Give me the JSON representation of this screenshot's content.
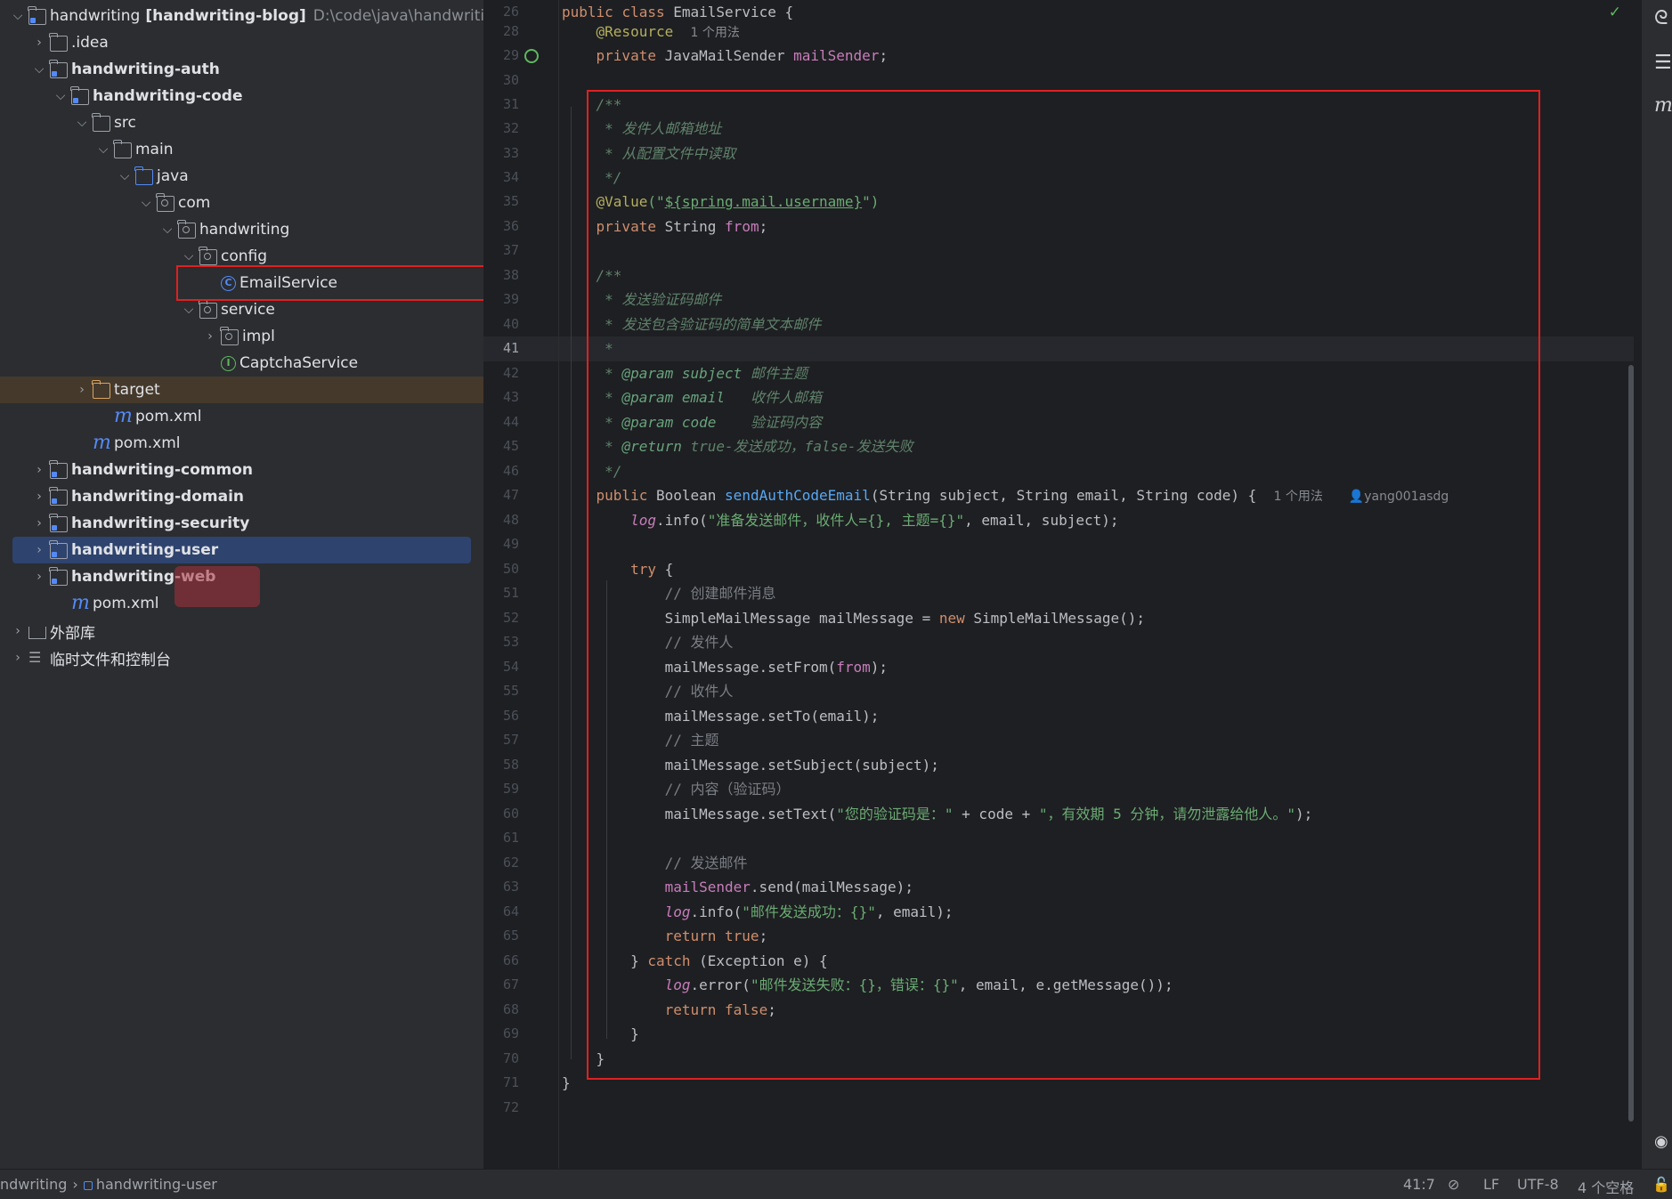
{
  "project_tree": {
    "rows": [
      {
        "label": "handwriting",
        "extra": "[handwriting-blog]",
        "path": "D:\\code\\java\\handwriting",
        "icon": "module-folder-icon",
        "expanded": true,
        "indent": 0
      },
      {
        "label": ".idea",
        "icon": "folder-icon",
        "expanded": false,
        "indent": 1
      },
      {
        "label": "handwriting-auth",
        "icon": "module-folder-icon",
        "expanded": true,
        "indent": 1,
        "bold": true
      },
      {
        "label": "handwriting-code",
        "icon": "module-folder-icon",
        "expanded": true,
        "indent": 2,
        "bold": true
      },
      {
        "label": "src",
        "icon": "folder-icon",
        "expanded": true,
        "indent": 3
      },
      {
        "label": "main",
        "icon": "folder-icon",
        "expanded": true,
        "indent": 4
      },
      {
        "label": "java",
        "icon": "source-folder-icon",
        "expanded": true,
        "indent": 5
      },
      {
        "label": "com",
        "icon": "package-icon",
        "expanded": true,
        "indent": 6
      },
      {
        "label": "handwriting",
        "icon": "package-icon",
        "expanded": true,
        "indent": 7
      },
      {
        "label": "config",
        "icon": "package-icon",
        "expanded": true,
        "indent": 8
      },
      {
        "label": "EmailService",
        "icon": "class-icon",
        "indent": 9
      },
      {
        "label": "service",
        "icon": "package-icon",
        "expanded": true,
        "indent": 8
      },
      {
        "label": "impl",
        "icon": "package-icon",
        "expanded": false,
        "indent": 9
      },
      {
        "label": "CaptchaService",
        "icon": "interface-icon",
        "indent": 9
      },
      {
        "label": "target",
        "icon": "excluded-folder-icon",
        "expanded": false,
        "indent": 3
      },
      {
        "label": "pom.xml",
        "icon": "maven-icon",
        "indent": 4
      },
      {
        "label": "pom.xml",
        "icon": "maven-icon",
        "indent": 3
      },
      {
        "label": "handwriting-common",
        "icon": "module-folder-icon",
        "expanded": false,
        "indent": 1,
        "bold": true
      },
      {
        "label": "handwriting-domain",
        "icon": "module-folder-icon",
        "expanded": false,
        "indent": 1,
        "bold": true
      },
      {
        "label": "handwriting-security",
        "icon": "module-folder-icon",
        "expanded": false,
        "indent": 1,
        "bold": true
      },
      {
        "label": "handwriting-user",
        "icon": "module-folder-icon",
        "expanded": false,
        "indent": 1,
        "bold": true,
        "selected": true
      },
      {
        "label": "handwriting-web",
        "icon": "module-folder-icon",
        "expanded": false,
        "indent": 1,
        "bold": true
      },
      {
        "label": "pom.xml",
        "icon": "maven-icon",
        "indent": 2
      },
      {
        "label": "外部库",
        "icon": "library-icon",
        "expanded": false,
        "indent": 0
      },
      {
        "label": "临时文件和控制台",
        "icon": "scratches-icon",
        "expanded": false,
        "indent": 0
      }
    ]
  },
  "editor": {
    "current_line": "41",
    "usage_hint_1": "1 个用法",
    "usage_hint_2": "1 个用法",
    "author_hint": "yang001asdg",
    "lines": [
      {
        "n": "26"
      },
      {
        "n": "28"
      },
      {
        "n": "29"
      },
      {
        "n": "30"
      },
      {
        "n": "31"
      },
      {
        "n": "32"
      },
      {
        "n": "33"
      },
      {
        "n": "34"
      },
      {
        "n": "35"
      },
      {
        "n": "36"
      },
      {
        "n": "37"
      },
      {
        "n": "38"
      },
      {
        "n": "39"
      },
      {
        "n": "40"
      },
      {
        "n": "41"
      },
      {
        "n": "42"
      },
      {
        "n": "43"
      },
      {
        "n": "44"
      },
      {
        "n": "45"
      },
      {
        "n": "46"
      },
      {
        "n": "47"
      },
      {
        "n": "48"
      },
      {
        "n": "49"
      },
      {
        "n": "50"
      },
      {
        "n": "51"
      },
      {
        "n": "52"
      },
      {
        "n": "53"
      },
      {
        "n": "54"
      },
      {
        "n": "55"
      },
      {
        "n": "56"
      },
      {
        "n": "57"
      },
      {
        "n": "58"
      },
      {
        "n": "59"
      },
      {
        "n": "60"
      },
      {
        "n": "61"
      },
      {
        "n": "62"
      },
      {
        "n": "63"
      },
      {
        "n": "64"
      },
      {
        "n": "65"
      },
      {
        "n": "66"
      },
      {
        "n": "67"
      },
      {
        "n": "68"
      },
      {
        "n": "69"
      },
      {
        "n": "70"
      },
      {
        "n": "71"
      },
      {
        "n": "72"
      }
    ],
    "text": {
      "public": "public",
      "class": "class",
      "class_name": "EmailService",
      "brace_open": " {",
      "resource": "@Resource",
      "private": "private",
      "mail_sender_type": "JavaMailSender",
      "mail_sender": "mailSender",
      "semi": ";",
      "doc_open": "/**",
      "doc_l32": " * 发件人邮箱地址",
      "doc_l33": " * 从配置文件中读取",
      "doc_close": " */",
      "value_ann": "@Value",
      "value_open": "(\"",
      "value_expr": "${spring.mail.username}",
      "value_close": "\")",
      "string_type": "String",
      "from": "from",
      "doc_l39": " * 发送验证码邮件",
      "doc_l40": " * 发送包含验证码的简单文本邮件",
      "doc_l41": " *",
      "doc_star": " * ",
      "param_tag": "@param",
      "return_tag": "@return",
      "p_subject": "subject",
      "p_subject_desc": "邮件主题",
      "p_email": "email",
      "p_email_desc": "收件人邮箱",
      "p_code": "code",
      "p_code_desc": "验证码内容",
      "return_desc": "true-发送成功，false-发送失败",
      "boolean_type": "Boolean",
      "method_name": "sendAuthCodeEmail",
      "method_params": "(String subject, String email, String code) {",
      "log": "log",
      "info": ".info(",
      "error": ".error(",
      "log_l48_str": "\"准备发送邮件，收件人={}, 主题={}\"",
      "log_l48_args": ", email, subject);",
      "try": "try",
      "c_l51": "// 创建邮件消息",
      "l52_a": "SimpleMailMessage mailMessage = ",
      "new": "new",
      "l52_b": " SimpleMailMessage();",
      "c_l53": "// 发件人",
      "set_from": "mailMessage.setFrom(",
      "close_paren_semi": ");",
      "c_l55": "// 收件人",
      "set_to": "mailMessage.setTo(email);",
      "c_l57": "// 主题",
      "set_subject": "mailMessage.setSubject(subject);",
      "c_l59": "// 内容（验证码）",
      "set_text_a": "mailMessage.setText(",
      "set_text_s1": "\"您的验证码是：\"",
      "set_text_mid": " + code + ",
      "set_text_s2": "\"，有效期 5 分钟，请勿泄露给他人。\"",
      "c_l62": "// 发送邮件",
      "send": ".send(mailMessage);",
      "log_l64_str": "\"邮件发送成功：{}\"",
      "log_l64_args": ", email);",
      "return": "return",
      "true": "true",
      "false": "false",
      "brace_close": "}",
      "catch": "catch",
      "catch_args": " (Exception e) {",
      "log_l67_str": "\"邮件发送失败：{}，错误：{}\"",
      "log_l67_args": ", email, e.getMessage());"
    }
  },
  "status_bar": {
    "breadcrumb_root": "ndwriting",
    "breadcrumb_module": "handwriting-user",
    "position": "41:7",
    "line_separator": "LF",
    "encoding": "UTF-8",
    "indent": "4 个空格"
  },
  "colors": {
    "highlight_box": "#e02020",
    "selection": "#2e436e",
    "accent_blue": "#548af7"
  }
}
